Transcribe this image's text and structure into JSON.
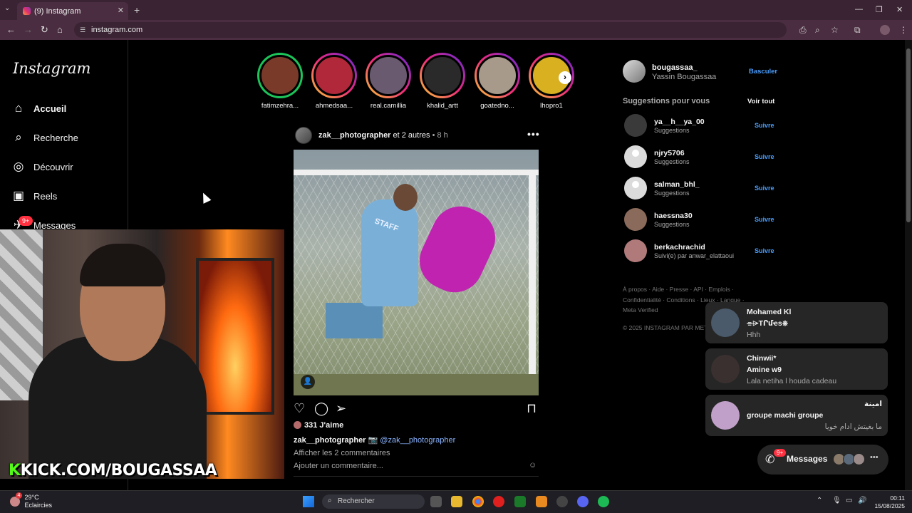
{
  "browser": {
    "tab_title": "(9) Instagram",
    "url": "instagram.com"
  },
  "nav": {
    "logo": "Instagram",
    "items": [
      {
        "label": "Accueil",
        "icon": "home-icon"
      },
      {
        "label": "Recherche",
        "icon": "search-icon"
      },
      {
        "label": "Découvrir",
        "icon": "compass-icon"
      },
      {
        "label": "Reels",
        "icon": "reels-icon"
      },
      {
        "label": "Messages",
        "icon": "messenger-icon"
      }
    ],
    "messages_badge": "9+"
  },
  "overlay": {
    "kick_k": "K",
    "kick_text": "KICK.COM/BOUGASSAA"
  },
  "stories": [
    {
      "name": "fatimzehra...",
      "color": "#7a3a2a"
    },
    {
      "name": "ahmedsaa...",
      "color": "#b0283a"
    },
    {
      "name": "real.camillia",
      "color": "#6a5a70"
    },
    {
      "name": "khalid_artt",
      "color": "#2a2a2a"
    },
    {
      "name": "goatedno...",
      "color": "#a89a8a"
    },
    {
      "name": "lhopro1",
      "color": "#d8b020"
    }
  ],
  "post": {
    "username": "zak__photographer",
    "coauthors": "et 2 autres",
    "dot": "•",
    "time": "8 h",
    "more": "•••",
    "likes": "331 J'aime",
    "caption_user": "zak__photographer",
    "caption_emoji": "📷",
    "caption_mention": "@zak__photographer",
    "view_comments": "Afficher les 2 commentaires",
    "add_comment": "Ajouter un commentaire...",
    "image_text": "STAFF"
  },
  "sidebar": {
    "me_username": "bougassaa_",
    "me_name": "Yassin Bougassaa",
    "switch_label": "Basculer",
    "suggestions_title": "Suggestions pour vous",
    "see_all": "Voir tout",
    "follow_label": "Suivre",
    "suggestions": [
      {
        "username": "ya__h__ya_00",
        "sub": "Suggestions",
        "avatar": "#3a3a3a",
        "default": false
      },
      {
        "username": "njry5706",
        "sub": "Suggestions",
        "avatar": "#dbdbdb",
        "default": true
      },
      {
        "username": "salman_bhl_",
        "sub": "Suggestions",
        "avatar": "#dbdbdb",
        "default": true
      },
      {
        "username": "haessna30",
        "sub": "Suggestions",
        "avatar": "#8a6a5a",
        "default": false
      },
      {
        "username": "berkachrachid",
        "sub": "Suivi(e) par anwar_elattaoui",
        "avatar": "#b07a7a",
        "default": false
      }
    ],
    "footer": "À propos · Aide · Presse · API · Emplois · Confidentialité · Conditions · Lieux · Langue · Meta Verified",
    "copyright": "© 2025 INSTAGRAM PAR META"
  },
  "popups": [
    {
      "title": "Mohamed Kl",
      "subtitle": "⌯⌲TՐմҽs⎈",
      "message": "Hhh",
      "avatar": "#4a5a6a"
    },
    {
      "title": "Chinwii*",
      "subtitle": "Amine w9",
      "message": "Lala netiha l houda cadeau",
      "avatar": "#3a3030"
    },
    {
      "title": "امينة",
      "subtitle": "groupe machi groupe",
      "message": "ما بغيتش ادام خويا",
      "avatar": "#c0a0c8"
    }
  ],
  "messages_pill": {
    "label": "Messages",
    "badge": "9+",
    "avatars": [
      "#8a7a6a",
      "#5a6a7a",
      "#9a8a8a"
    ],
    "more": "•••"
  },
  "taskbar": {
    "temp": "29°C",
    "condition": "Eclaircies",
    "weather_badge": "4",
    "search_placeholder": "Rechercher",
    "time": "00:11",
    "date": "15/08/2025"
  }
}
